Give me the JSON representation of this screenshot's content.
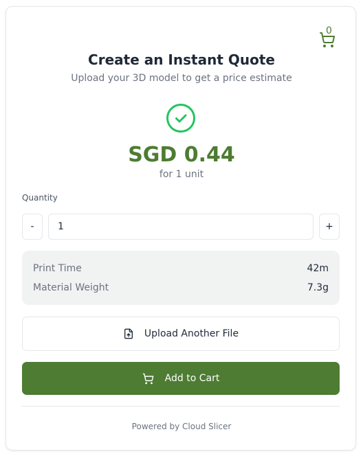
{
  "cart": {
    "count": "0",
    "icon": "cart-icon"
  },
  "header": {
    "title": "Create an Instant Quote",
    "subtitle": "Upload your 3D model to get a price estimate"
  },
  "quote": {
    "status_icon": "check-circle-icon",
    "price": "SGD 0.44",
    "per_unit": "for 1 unit"
  },
  "quantity": {
    "label": "Quantity",
    "decrement_label": "-",
    "value": "1",
    "increment_label": "+"
  },
  "stats": [
    {
      "label": "Print Time",
      "value": "42m"
    },
    {
      "label": "Material Weight",
      "value": "7.3g"
    }
  ],
  "actions": {
    "upload_label": "Upload Another File",
    "upload_icon": "file-upload-icon",
    "add_to_cart_label": "Add to Cart",
    "add_to_cart_icon": "cart-icon"
  },
  "footer": {
    "powered_by": "Powered by Cloud Slicer"
  },
  "colors": {
    "accent": "#4d7c32",
    "success": "#22c55e",
    "muted_text": "#6b7280",
    "stats_background": "#f1f2f2"
  }
}
